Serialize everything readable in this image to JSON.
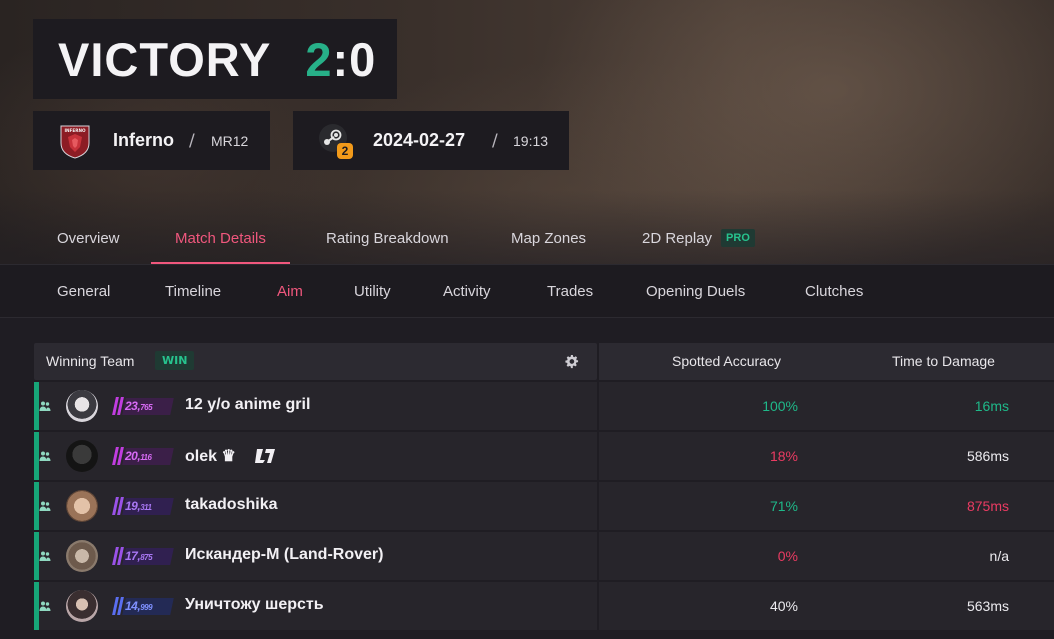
{
  "header": {
    "result": "VICTORY",
    "score_team": "2",
    "score_sep": ":",
    "score_enemy": "0",
    "map_name": "Inferno",
    "map_logo_text": "INFERNO",
    "mode": "MR12",
    "date": "2024-02-27",
    "time": "19:13",
    "platform_badge": "2"
  },
  "main_tabs": [
    {
      "label": "Overview"
    },
    {
      "label": "Match Details"
    },
    {
      "label": "Rating Breakdown"
    },
    {
      "label": "Map Zones"
    },
    {
      "label": "2D Replay",
      "badge": "PRO"
    }
  ],
  "sub_tabs": [
    {
      "label": "General"
    },
    {
      "label": "Timeline"
    },
    {
      "label": "Aim"
    },
    {
      "label": "Utility"
    },
    {
      "label": "Activity"
    },
    {
      "label": "Trades"
    },
    {
      "label": "Opening Duels"
    },
    {
      "label": "Clutches"
    }
  ],
  "table": {
    "team_label": "Winning Team",
    "win_badge": "WIN",
    "columns": [
      "Spotted Accuracy",
      "Time to Damage"
    ],
    "rows": [
      {
        "name": "12 y/o anime gril",
        "rating_main": "23,",
        "rating_small": "765",
        "spotted_accuracy": "100%",
        "time_to_damage": "16ms"
      },
      {
        "name": "olek ♛",
        "rating_main": "20,",
        "rating_small": "116",
        "spotted_accuracy": "18%",
        "time_to_damage": "586ms"
      },
      {
        "name": "takadoshika",
        "rating_main": "19,",
        "rating_small": "311",
        "spotted_accuracy": "71%",
        "time_to_damage": "875ms"
      },
      {
        "name": "Искандер-М (Land-Rover)",
        "rating_main": "17,",
        "rating_small": "875",
        "spotted_accuracy": "0%",
        "time_to_damage": "n/a"
      },
      {
        "name": "Уничтожу шерсть",
        "rating_main": "14,",
        "rating_small": "999",
        "spotted_accuracy": "40%",
        "time_to_damage": "563ms"
      }
    ]
  },
  "colors": {
    "accent": "#f0577d",
    "win_green": "#27b088",
    "good": "#1fb889",
    "bad": "#ea3b62"
  }
}
